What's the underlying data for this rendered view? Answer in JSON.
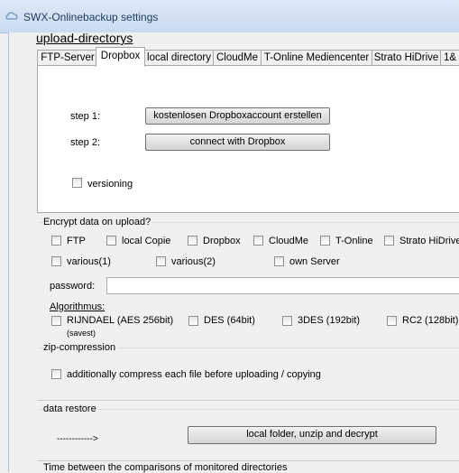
{
  "window": {
    "title": "SWX-Onlinebackup settings"
  },
  "section_title": "upload-directorys",
  "tabs": [
    "FTP-Server",
    "Dropbox",
    "local directory",
    "CloudMe",
    "T-Online Mediencenter",
    "Strato HiDrive",
    "1&"
  ],
  "active_tab": "Dropbox",
  "dropbox": {
    "step1_label": "step 1:",
    "step1_button": "kostenlosen Dropboxaccount erstellen",
    "step2_label": "step 2:",
    "step2_button": "connect with Dropbox",
    "versioning_label": "versioning"
  },
  "encrypt": {
    "title": "Encrypt data on upload?",
    "targets": [
      "FTP",
      "local Copie",
      "Dropbox",
      "CloudMe",
      "T-Online",
      "Strato HiDrive",
      "various(1)",
      "various(2)",
      "own Server"
    ],
    "password_label": "password:",
    "password_value": "",
    "algorithm_label": "Algorithmus:",
    "algorithms": [
      "RIJNDAEL (AES 256bit)",
      "DES (64bit)",
      "3DES (192bit)",
      "RC2 (128bit)"
    ],
    "algorithm_note": "(savest)"
  },
  "zip": {
    "title": "zip-compression",
    "option_label": "additionally compress each file before uploading / copying"
  },
  "restore": {
    "title": "data restore",
    "arrow_text": "------------>",
    "button_label": "local folder, unzip and decrypt"
  },
  "monitor": {
    "title": "Time between the comparisons of monitored directories"
  }
}
